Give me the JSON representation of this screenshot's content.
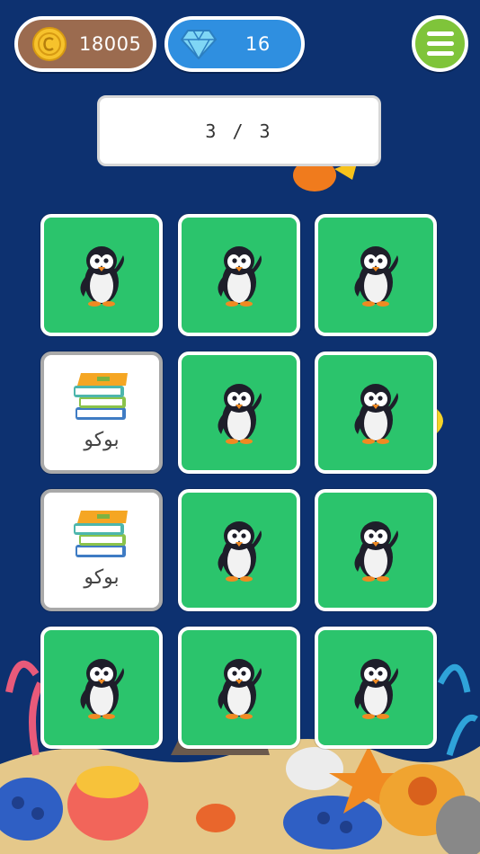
{
  "hud": {
    "coins": "18005",
    "gems": "16",
    "coin_icon": "coin-icon",
    "gem_icon": "diamond-icon",
    "menu_icon": "hamburger-icon"
  },
  "progress": {
    "label": "3 / 3",
    "current": 3,
    "total": 3
  },
  "cards": [
    {
      "state": "hidden",
      "icon": "penguin-icon"
    },
    {
      "state": "hidden",
      "icon": "penguin-icon"
    },
    {
      "state": "hidden",
      "icon": "penguin-icon"
    },
    {
      "state": "revealed",
      "icon": "books-icon",
      "label": "بوکو"
    },
    {
      "state": "hidden",
      "icon": "penguin-icon"
    },
    {
      "state": "hidden",
      "icon": "penguin-icon"
    },
    {
      "state": "revealed",
      "icon": "books-icon",
      "label": "بوکو"
    },
    {
      "state": "hidden",
      "icon": "penguin-icon"
    },
    {
      "state": "hidden",
      "icon": "penguin-icon"
    },
    {
      "state": "hidden",
      "icon": "penguin-icon"
    },
    {
      "state": "hidden",
      "icon": "penguin-icon"
    },
    {
      "state": "hidden",
      "icon": "penguin-icon"
    }
  ],
  "colors": {
    "background": "#0d3170",
    "card_back": "#2bc46c",
    "coin_pill": "#9b6b4f",
    "gem_pill": "#2f8fe0",
    "menu": "#7fc43a"
  }
}
